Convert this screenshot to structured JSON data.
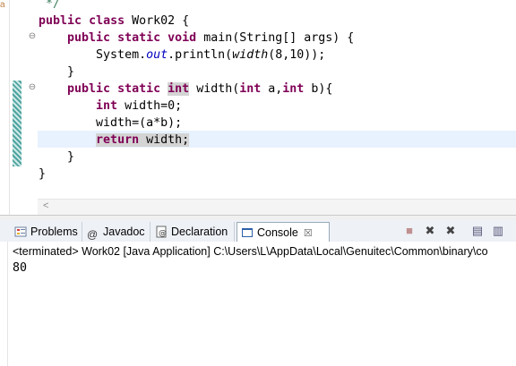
{
  "editor": {
    "left_char": "a",
    "lines": [
      {
        "parts": [
          {
            "t": " */",
            "c": "cmt"
          }
        ]
      },
      {
        "parts": [
          {
            "t": "public",
            "c": "kw"
          },
          {
            "t": " "
          },
          {
            "t": "class",
            "c": "kw"
          },
          {
            "t": " Work02 {"
          }
        ]
      },
      {
        "parts": [
          {
            "t": "    "
          },
          {
            "t": "public",
            "c": "kw"
          },
          {
            "t": " "
          },
          {
            "t": "static",
            "c": "kw"
          },
          {
            "t": " "
          },
          {
            "t": "void",
            "c": "kw"
          },
          {
            "t": " main(String[] args) {"
          }
        ]
      },
      {
        "parts": [
          {
            "t": "        System."
          },
          {
            "t": "out",
            "c": "st"
          },
          {
            "t": ".println("
          },
          {
            "t": "width",
            "c": "mi"
          },
          {
            "t": "(8,10));"
          }
        ]
      },
      {
        "parts": [
          {
            "t": "    }"
          }
        ]
      },
      {
        "parts": [
          {
            "t": "    "
          },
          {
            "t": "public",
            "c": "kw"
          },
          {
            "t": " "
          },
          {
            "t": "static",
            "c": "kw"
          },
          {
            "t": " "
          },
          {
            "t": "int",
            "c": "kw mark"
          },
          {
            "t": " width("
          },
          {
            "t": "int",
            "c": "kw"
          },
          {
            "t": " a,"
          },
          {
            "t": "int",
            "c": "kw"
          },
          {
            "t": " b){"
          }
        ]
      },
      {
        "parts": [
          {
            "t": "        "
          },
          {
            "t": "int",
            "c": "kw"
          },
          {
            "t": " width=0;"
          }
        ]
      },
      {
        "parts": [
          {
            "t": "        width=(a*b);"
          }
        ]
      },
      {
        "parts": [
          {
            "t": "        "
          },
          {
            "t": "return",
            "c": "kw mark"
          },
          {
            "t": " width;",
            "c": "mark"
          }
        ]
      },
      {
        "parts": [
          {
            "t": "    }"
          }
        ]
      },
      {
        "parts": [
          {
            "t": "}"
          }
        ]
      }
    ],
    "fold_markers": [
      "⊖",
      "⊖"
    ],
    "scroll_arrow": "<"
  },
  "tabs": [
    {
      "label": "Problems",
      "icon": "problems-icon",
      "active": false
    },
    {
      "label": "Javadoc",
      "icon": "at-icon",
      "active": false
    },
    {
      "label": "Declaration",
      "icon": "declaration-icon",
      "active": false
    },
    {
      "label": "Console",
      "icon": "console-icon",
      "active": true,
      "close": "☒"
    }
  ],
  "tab_icons": {
    "javadoc": "@"
  },
  "toolbar": [
    "■",
    "✖",
    "✖",
    "▤",
    "▥"
  ],
  "console": {
    "terminated": "<terminated> Work02 [Java Application] C:\\Users\\L\\AppData\\Local\\Genuitec\\Common\\binary\\co",
    "output": "80"
  },
  "colors": {
    "keyword": "#7f0055",
    "comment": "#3f7f5f",
    "static_field": "#0000c0",
    "current_line": "#e8f2fe",
    "tab_bar": "#eef1f6"
  }
}
